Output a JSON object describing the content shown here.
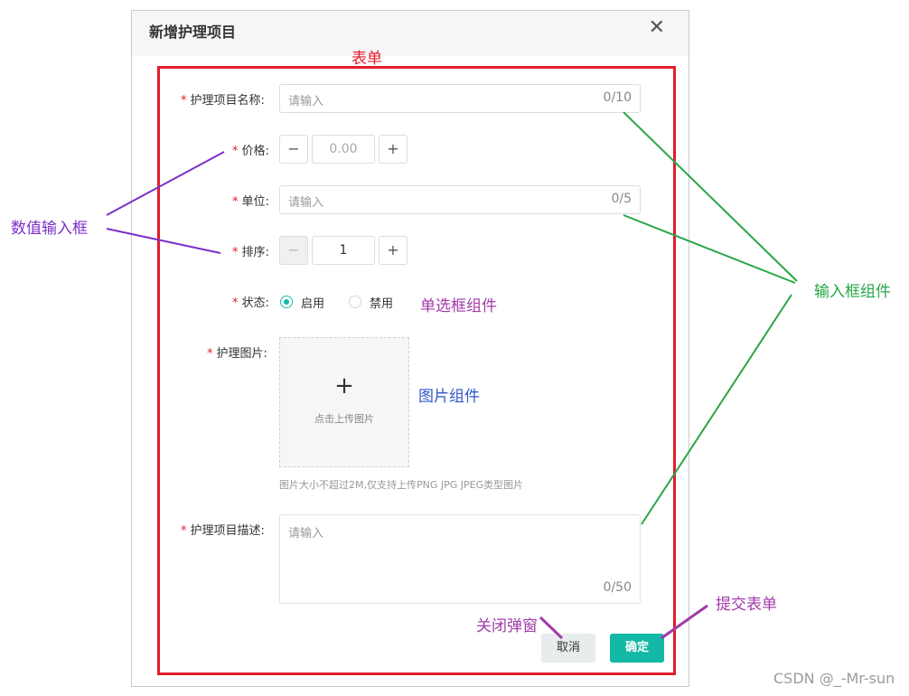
{
  "dialog": {
    "title": "新增护理项目",
    "close_symbol": "✕"
  },
  "form": {
    "name": {
      "label": "护理项目名称:",
      "placeholder": "请输入",
      "counter": "0/10"
    },
    "price": {
      "label": "价格:",
      "value": "0.00",
      "minus": "−",
      "plus": "+"
    },
    "unit": {
      "label": "单位:",
      "placeholder": "请输入",
      "counter": "0/5"
    },
    "sort": {
      "label": "排序:",
      "value": "1",
      "minus": "−",
      "plus": "+"
    },
    "status": {
      "label": "状态:",
      "options": [
        "启用",
        "禁用"
      ],
      "selected": "启用"
    },
    "image": {
      "label": "护理图片:",
      "plus": "+",
      "upload_text": "点击上传图片",
      "hint": "图片大小不超过2M,仅支持上传PNG JPG JPEG类型图片"
    },
    "description": {
      "label": "护理项目描述:",
      "placeholder": "请输入",
      "counter": "0/50"
    },
    "required_mark": "*"
  },
  "buttons": {
    "cancel": "取消",
    "ok": "确定"
  },
  "annotations": {
    "form": "表单",
    "numeric_input": "数值输入框",
    "input_component": "输入框组件",
    "radio_component": "单选框组件",
    "image_component": "图片组件",
    "close_dialog": "关闭弹窗",
    "submit_form": "提交表单"
  },
  "watermark": "CSDN @_-Mr-sun",
  "colors": {
    "accent": "#14b8a6",
    "required": "#e11d2d",
    "frame": "#e11d2d",
    "annotation_purple": "#7b2fc9",
    "annotation_green": "#27a646",
    "annotation_magenta": "#a23aa8",
    "annotation_blue": "#3157c9"
  }
}
